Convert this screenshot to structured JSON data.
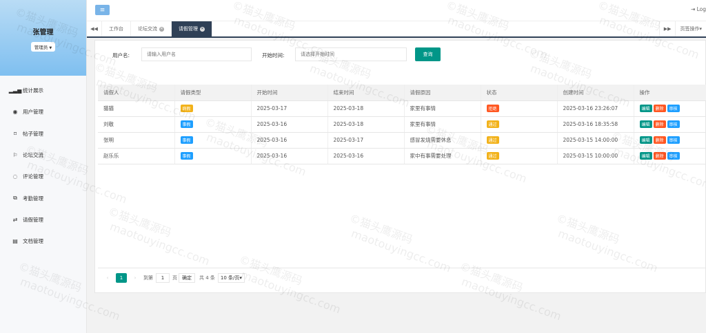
{
  "sidebar": {
    "user_name": "张管理",
    "role": "管理员",
    "items": [
      {
        "label": "统计展示",
        "icon": "▂▃▅"
      },
      {
        "label": "用户管理",
        "icon": "◉"
      },
      {
        "label": "帖子管理",
        "icon": "⌑"
      },
      {
        "label": "论坛交流",
        "icon": "⚐"
      },
      {
        "label": "评论管理",
        "icon": "◌"
      },
      {
        "label": "考勤管理",
        "icon": "⧉"
      },
      {
        "label": "请假管理",
        "icon": "⇄"
      },
      {
        "label": "文档管理",
        "icon": "▤"
      }
    ]
  },
  "header": {
    "menu_icon": "≡",
    "logout_label": "Log"
  },
  "tabs": {
    "items": [
      {
        "label": "工作台"
      },
      {
        "label": "论坛交流"
      },
      {
        "label": "请假管理"
      }
    ],
    "page_ops_label": "页签操作"
  },
  "search": {
    "username_label": "用户名:",
    "username_placeholder": "请输入用户名",
    "start_label": "开始时间:",
    "start_placeholder": "请选择开始时间",
    "query_button": "查询"
  },
  "table": {
    "columns": [
      "请假人",
      "请假类型",
      "开始时间",
      "结束时间",
      "请假原因",
      "状态",
      "创建时间",
      "操作"
    ],
    "rows": [
      {
        "name": "猫猫",
        "type": "病假",
        "start": "2025-03-17",
        "end": "2025-03-18",
        "reason": "家里有事情",
        "status": "拒绝",
        "created": "2025-03-16 23:26:07"
      },
      {
        "name": "刘敬",
        "type": "事假",
        "start": "2025-03-16",
        "end": "2025-03-18",
        "reason": "家里有事情",
        "status": "通过",
        "created": "2025-03-16 18:35:58"
      },
      {
        "name": "张明",
        "type": "事假",
        "start": "2025-03-16",
        "end": "2025-03-17",
        "reason": "感冒发烧需要休息",
        "status": "通过",
        "created": "2025-03-15 14:00:00"
      },
      {
        "name": "赵乐乐",
        "type": "事假",
        "start": "2025-03-16",
        "end": "2025-03-16",
        "reason": "家中有事需要处理",
        "status": "通过",
        "created": "2025-03-15 10:00:00"
      }
    ],
    "actions": [
      "编辑",
      "删除",
      "审核"
    ]
  },
  "colors": {
    "sick": "#f2b21a",
    "personal": "#1e9fff",
    "reject": "#ff5722",
    "approve": "#f2b21a",
    "edit": "#009688",
    "delete": "#ff5722",
    "audit": "#1e9fff"
  },
  "pagination": {
    "prev": "‹",
    "current": "1",
    "next": "›",
    "goto_label": "到第",
    "goto_value": "1",
    "page_unit": "页",
    "confirm": "确定",
    "total": "共 4 条",
    "page_size": "10 条/页"
  },
  "watermark": {
    "line1": "©猫头鹰源码",
    "line2": "maotouyingcc.com"
  }
}
